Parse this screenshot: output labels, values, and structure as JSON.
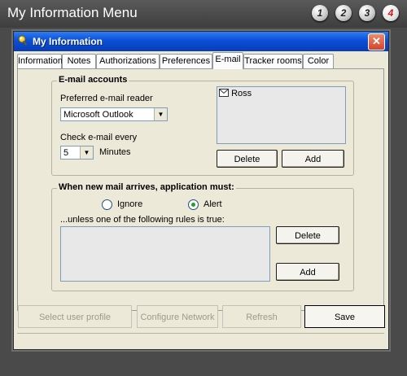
{
  "outer": {
    "title": "My Information Menu",
    "steps": [
      "1",
      "2",
      "3",
      "4"
    ],
    "active_step": "4"
  },
  "window": {
    "title": "My Information",
    "close_label": "✕"
  },
  "tabs": [
    "Information",
    "Notes",
    "Authorizations",
    "Preferences",
    "E-mail",
    "Tracker rooms",
    "Color"
  ],
  "active_tab": "E-mail",
  "email_accounts": {
    "group_label": "E-mail accounts",
    "reader_label": "Preferred e-mail reader",
    "reader_value": "Microsoft Outlook",
    "check_label": "Check e-mail every",
    "check_value": "5",
    "minutes_label": "Minutes",
    "accounts": [
      "Ross"
    ],
    "delete_label": "Delete",
    "add_label": "Add"
  },
  "new_mail": {
    "group_label": "When new mail arrives, application must:",
    "ignore_label": "Ignore",
    "alert_label": "Alert",
    "selected": "Alert",
    "rules_label": "...unless one of the following rules is true:",
    "delete_label": "Delete",
    "add_label": "Add"
  },
  "bottom_buttons": {
    "select_profile": "Select user profile",
    "configure_network": "Configure Network",
    "refresh": "Refresh",
    "save": "Save"
  }
}
